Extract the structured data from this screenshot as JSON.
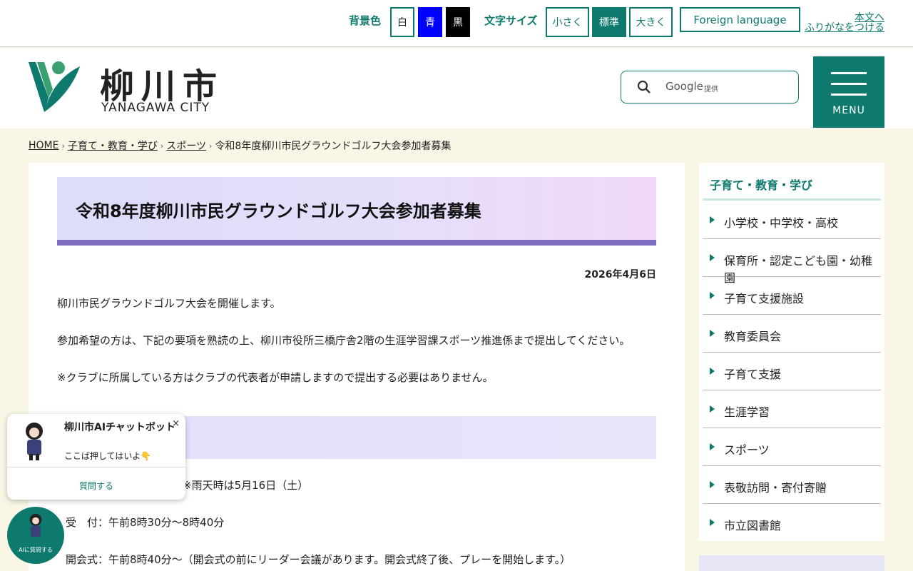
{
  "topbar": {
    "bg_label": "背景色",
    "bg_white": "白",
    "bg_blue": "青",
    "bg_black": "黒",
    "fontsize_label": "文字サイズ",
    "fs_small": "小さく",
    "fs_std": "標準",
    "fs_large": "大きく",
    "foreign": "Foreign language",
    "furigana_line1": "本文へ",
    "furigana_line2": "ふりがなをつける"
  },
  "header": {
    "logo_jp": "柳川市",
    "logo_en": "YANAGAWA CITY",
    "search_google": "Google",
    "search_provided": "提供",
    "menu_label": "MENU"
  },
  "breadcrumb": {
    "home": "HOME",
    "level1": "子育て・教育・学び",
    "level2": "スポーツ",
    "current": "令和8年度柳川市民グラウンドゴルフ大会参加者募集",
    "sep": "›"
  },
  "article": {
    "title": "令和8年度柳川市民グラウンドゴルフ大会参加者募集",
    "date": "2026年4月6日",
    "p1": "柳川市民グラウンドゴルフ大会を開催します。",
    "p2": "参加希望の方は、下記の要項を熟読の上、柳川市役所三橋庁舎2階の生涯学習課スポーツ推進係まで提出してください。",
    "p3": "※クラブに所属している方はクラブの代表者が申請しますので提出する必要はありません。",
    "p4": "※雨天時は5月16日（土）",
    "p5": "受　付：午前8時30分～8時40分",
    "p6": "開会式：午前8時40分～（開会式の前にリーダー会議があります。開会式終了後、プレーを開始します。）"
  },
  "sidebar": {
    "title": "子育て・教育・学び",
    "items": [
      {
        "label": "小学校・中学校・高校"
      },
      {
        "label": "保育所・認定こども園・幼稚園"
      },
      {
        "label": "子育て支援施設"
      },
      {
        "label": "教育委員会"
      },
      {
        "label": "子育て支援"
      },
      {
        "label": "生涯学習"
      },
      {
        "label": "スポーツ"
      },
      {
        "label": "表敬訪問・寄付寄贈"
      },
      {
        "label": "市立図書館"
      }
    ]
  },
  "chatbot": {
    "title": "柳川市AIチャットボット",
    "subtitle": "ここば押してはいよ👇",
    "close": "×",
    "ask": "質問する",
    "fab_label": "AIに質問する"
  },
  "colors": {
    "accent": "#0e7a6e",
    "title_border": "#7e6cc0",
    "page_bg": "#f9f6e6"
  }
}
